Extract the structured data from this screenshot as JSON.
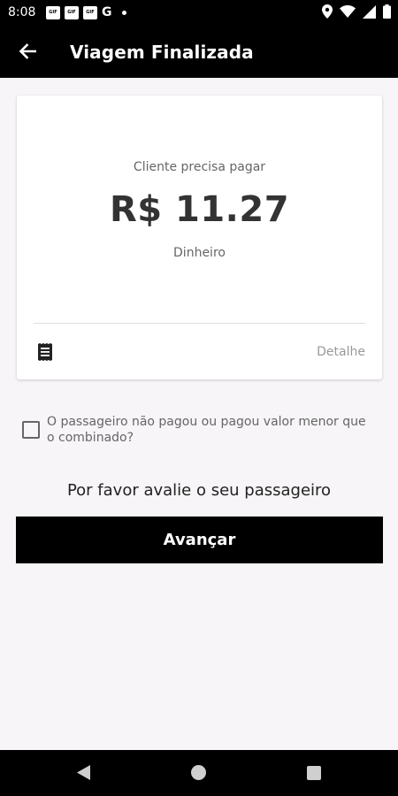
{
  "status_bar": {
    "time": "8:08",
    "notifications": [
      "GIF",
      "GIF",
      "GIF"
    ],
    "g_label": "G",
    "icons": [
      "location-icon",
      "wifi-icon",
      "signal-icon",
      "battery-icon"
    ]
  },
  "app_bar": {
    "title": "Viagem Finalizada",
    "back_icon": "arrow-left-icon"
  },
  "payment_card": {
    "label": "Cliente precisa pagar",
    "amount": "R$ 11.27",
    "method": "Dinheiro",
    "receipt_icon": "receipt-icon",
    "detail_link": "Detalhe"
  },
  "not_paid_checkbox": {
    "checked": false,
    "label": "O passageiro não pagou ou pagou valor menor que o combinado?"
  },
  "rating": {
    "prompt": "Por favor avalie o seu passageiro"
  },
  "next_button": {
    "label": "Avançar"
  },
  "nav_bar": {
    "icons": [
      "back-triangle-icon",
      "home-circle-icon",
      "recents-square-icon"
    ]
  },
  "colors": {
    "app_bar_bg": "#000000",
    "page_bg": "#f7f5f7",
    "button_bg": "#000000",
    "amount_text": "#333333",
    "muted_text": "#666666"
  }
}
